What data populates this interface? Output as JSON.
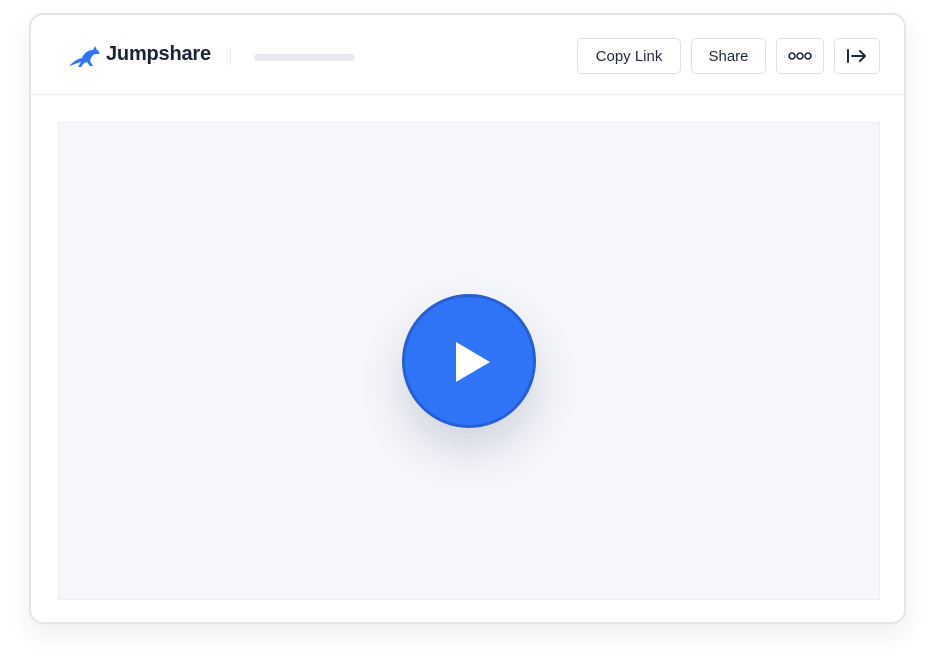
{
  "app": {
    "brand_name": "Jumpshare",
    "logo_icon": "kangaroo-icon"
  },
  "toolbar": {
    "copy_link_label": "Copy Link",
    "share_label": "Share",
    "more_icon": "more-dots-icon",
    "exit_icon": "exit-arrow-icon"
  },
  "player": {
    "play_icon": "play-icon"
  },
  "colors": {
    "accent": "#2f74f7",
    "brand_text": "#1b2436",
    "viewer_bg": "#f6f7fb"
  }
}
